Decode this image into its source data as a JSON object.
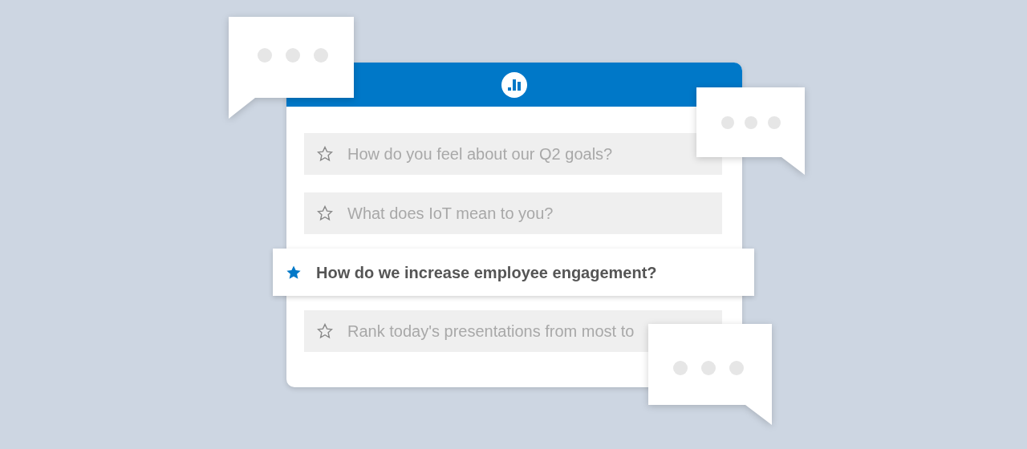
{
  "questions": [
    {
      "text": "How do you feel about our Q2 goals?",
      "selected": false
    },
    {
      "text": "What does IoT mean to you?",
      "selected": false
    },
    {
      "text": "How do we increase employee engagement?",
      "selected": true
    },
    {
      "text": "Rank today's presentations from most to",
      "selected": false
    }
  ]
}
